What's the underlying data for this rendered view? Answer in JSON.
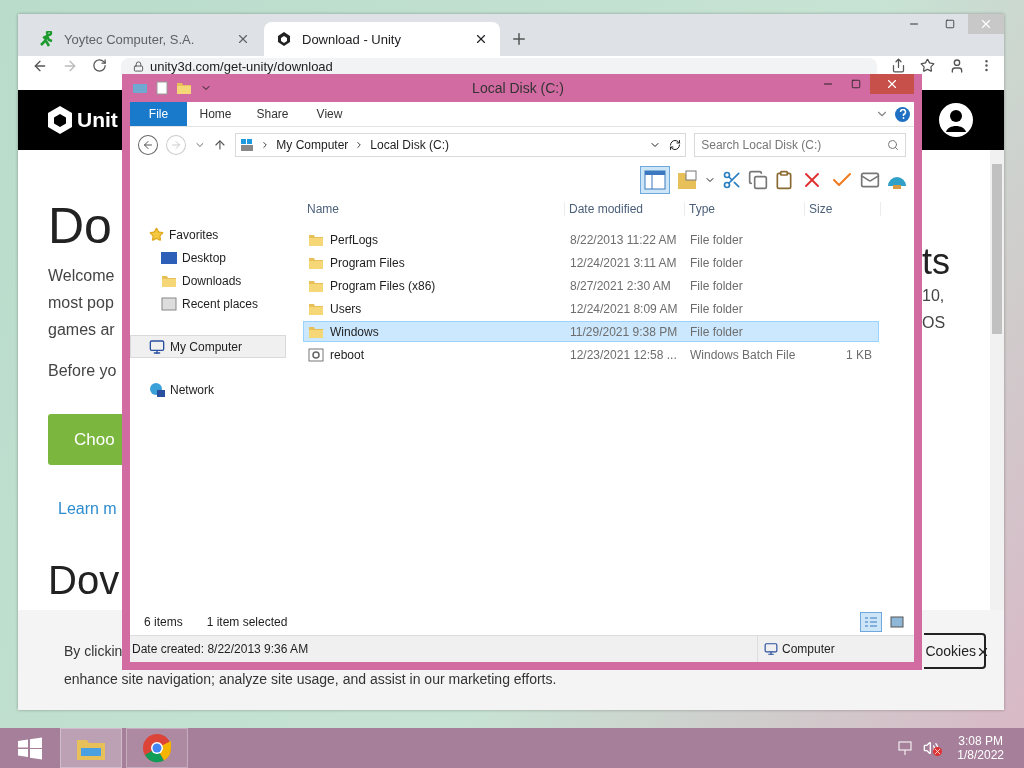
{
  "browser": {
    "tabs": [
      {
        "label": "Yoytec Computer, S.A.",
        "kind": "runner",
        "selected": false
      },
      {
        "label": "Download - Unity",
        "kind": "unity",
        "selected": true
      }
    ],
    "url": "unity3d.com/get-unity/download",
    "header": {
      "logo_text": "Unit"
    },
    "page": {
      "left": [
        {
          "kind": "h1",
          "text": "Do"
        },
        {
          "kind": "p",
          "text": "Welcome"
        },
        {
          "kind": "p",
          "text": "most pop"
        },
        {
          "kind": "p",
          "text": "games ar"
        },
        {
          "kind": "p2",
          "text": "Before yo"
        },
        {
          "kind": "button",
          "text": "Choo"
        },
        {
          "kind": "link",
          "text": "Learn m"
        },
        {
          "kind": "h2",
          "text": "Dov"
        }
      ],
      "right": [
        {
          "kind": "h3",
          "text": "ts"
        },
        {
          "kind": "p",
          "text": "10,"
        },
        {
          "kind": "p",
          "text": "OS"
        }
      ]
    },
    "cookie_banner": {
      "line_1": "By clickin",
      "line_2": "enhance site navigation; analyze site usage, and assist in our marketing efforts.",
      "button": "Cookies"
    }
  },
  "explorer": {
    "title": "Local Disk (C:)",
    "ribbon_tabs": [
      {
        "label": "File",
        "kind": "file"
      },
      {
        "label": "Home",
        "kind": "tab"
      },
      {
        "label": "Share",
        "kind": "tab"
      },
      {
        "label": "View",
        "kind": "tab"
      }
    ],
    "path": [
      "My Computer",
      "Local Disk (C:)"
    ],
    "search": {
      "placeholder": "Search Local Disk (C:)"
    },
    "toolbar": {
      "preview_pane": true
    },
    "nav": [
      {
        "label": "Favorites",
        "kind": "favorites",
        "selected": false,
        "children": [
          {
            "label": "Desktop",
            "kind": "desktop",
            "selected": false
          },
          {
            "label": "Downloads",
            "kind": "downloads",
            "selected": false
          },
          {
            "label": "Recent places",
            "kind": "recent",
            "selected": false
          }
        ]
      },
      {
        "label": "My Computer",
        "kind": "computer",
        "selected": true
      },
      {
        "label": "Network",
        "kind": "network",
        "selected": false
      }
    ],
    "columns": [
      "Name",
      "Date modified",
      "Type",
      "Size"
    ],
    "files": [
      {
        "name": "PerfLogs",
        "kind": "folder",
        "date": "8/22/2013 11:22 AM",
        "type": "File folder",
        "selected": false
      },
      {
        "name": "Program Files",
        "kind": "folder",
        "date": "12/24/2021 3:11 AM",
        "type": "File folder",
        "selected": false
      },
      {
        "name": "Program Files (x86)",
        "kind": "folder",
        "date": "8/27/2021 2:30 AM",
        "type": "File folder",
        "selected": false
      },
      {
        "name": "Users",
        "kind": "folder",
        "date": "12/24/2021 8:09 AM",
        "type": "File folder",
        "selected": false
      },
      {
        "name": "Windows",
        "kind": "folder",
        "date": "11/29/2021 9:38 PM",
        "type": "File folder",
        "selected": true
      },
      {
        "name": "reboot",
        "kind": "batch",
        "date": "12/23/2021 12:58 ...",
        "type": "Windows Batch File",
        "size": "1 KB",
        "selected": false
      }
    ],
    "status": {
      "count": "6 items",
      "selection": "1 item selected",
      "details_view": true
    },
    "details": {
      "text": "Date created: 8/22/2013 9:36 AM",
      "location": "Computer"
    }
  },
  "taskbar": {
    "apps": [
      {
        "kind": "explorer",
        "selected": true
      },
      {
        "kind": "chrome",
        "selected": false
      }
    ],
    "time": "3:08 PM",
    "date": "1/8/2022",
    "muted": true
  }
}
